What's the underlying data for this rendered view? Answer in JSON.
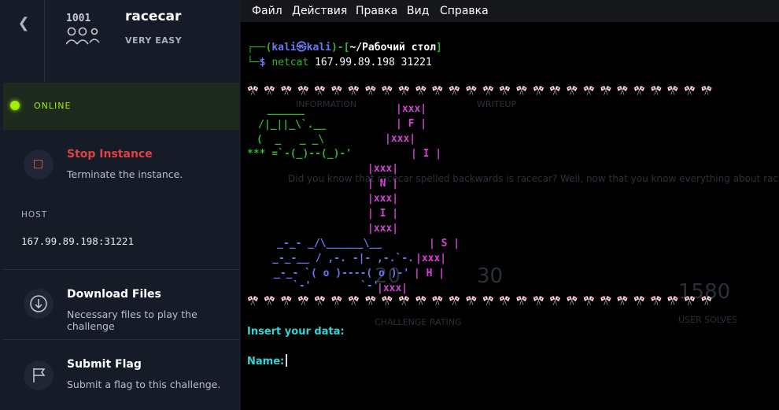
{
  "challenge": {
    "name": "racecar",
    "difficulty": "VERY EASY",
    "status": "ONLINE",
    "host_label": "HOST",
    "host_value": "167.99.89.198:31221",
    "icon_text": "1001"
  },
  "actions": {
    "stop": {
      "title": "Stop Instance",
      "subtitle": "Terminate the instance."
    },
    "download": {
      "title": "Download Files",
      "subtitle": "Necessary files to play the challenge"
    },
    "submit": {
      "title": "Submit Flag",
      "subtitle": "Submit a flag to this challenge."
    }
  },
  "terminal": {
    "menu": [
      "Файл",
      "Действия",
      "Правка",
      "Вид",
      "Справка"
    ],
    "prompt_user": "kali",
    "prompt_host": "kali",
    "prompt_path": "~/Рабочий стол",
    "prompt_symbol": "$",
    "command": "netcat",
    "command_args": "167.99.89.198 31221",
    "flags_row": "🎌 🎌 🎌 🎌 🎌 🎌 🎌 🎌 🎌 🎌 🎌 🎌 🎌 🎌 🎌 🎌 🎌 🎌 🎌 🎌 🎌 🎌 🎌 🎌 🎌 🎌 🎌 🎌",
    "car_art": [
      " ______",
      "/|_||_\\`.__",
      "(  _   _ _\\",
      "*** =`-(_)--(_)-'"
    ],
    "car2_art": [
      "_-_- _/\\______\\__",
      "_-_-__ / ,-. -|- ,-.`-.",
      "_-_- `( o )----( o )-'",
      "`-'        `-'"
    ],
    "letters": [
      "|xxx|",
      "| F |",
      "|xxx|",
      "| I |",
      "|xxx|",
      "| N |",
      "|xxx|",
      "| I |",
      "|xxx|",
      "| S |",
      "|xxx|",
      "| H |",
      "|xxx|"
    ],
    "input_prompt": "Insert your data:",
    "name_prompt": "Name:",
    "background_ghost": {
      "tab_info": "INFORMATION",
      "tab_writeup": "WRITEUP",
      "description": "Did you know that racecar spelled backwards is racecar? Well, now that you know everything about racing",
      "points": "20",
      "likes": "30",
      "solves": "1580",
      "solves_label": "USER SOLVES",
      "release_label": "CHALLENGE RATING"
    }
  },
  "colors": {
    "online": "#9fef00",
    "stop": "#e04141",
    "prompt_green": "#2fb52f",
    "prompt_blue": "#6b78f4",
    "magenta": "#d640d6",
    "cyan": "#2fd6d6"
  }
}
